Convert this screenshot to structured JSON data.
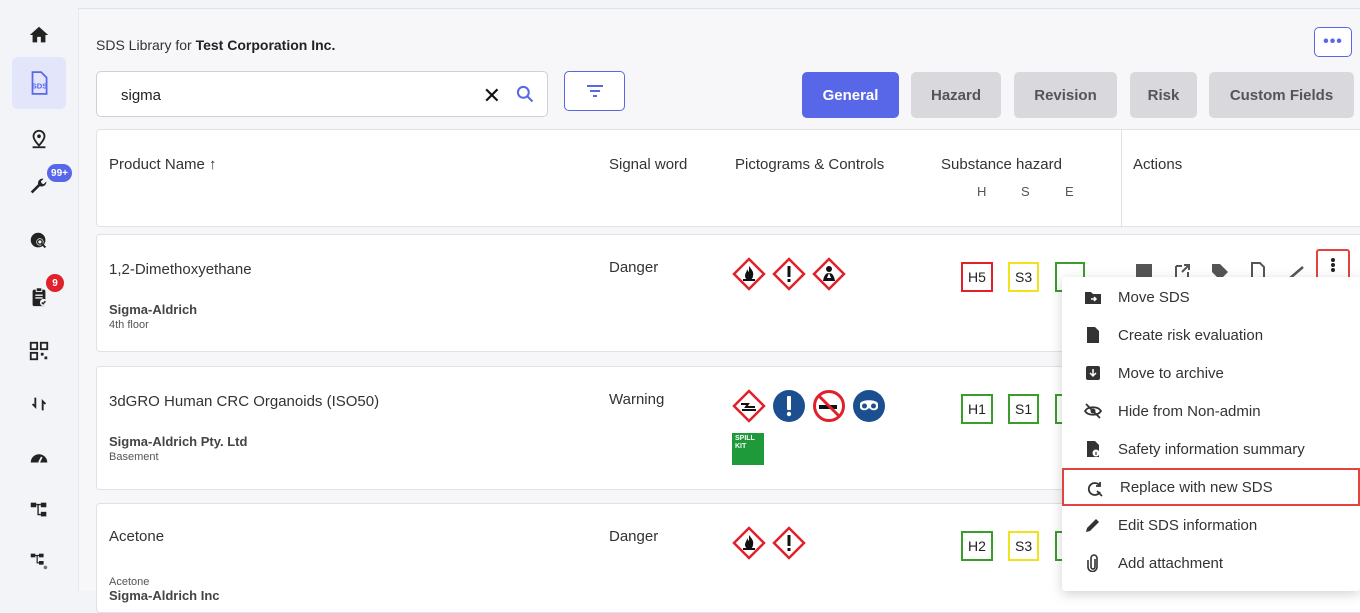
{
  "sidebar": {
    "items": [
      {
        "name": "home",
        "icon": "home-icon"
      },
      {
        "name": "sds",
        "icon": "sds-icon",
        "label": "SDS"
      },
      {
        "name": "locations",
        "icon": "location-pin-icon"
      },
      {
        "name": "tools",
        "icon": "wrench-icon",
        "badge": "99+"
      },
      {
        "name": "search-globe",
        "icon": "globe-search-icon"
      },
      {
        "name": "tasks",
        "icon": "clipboard-check-icon",
        "badge": "9"
      },
      {
        "name": "qr",
        "icon": "qr-code-icon"
      },
      {
        "name": "sync",
        "icon": "sync-icon"
      },
      {
        "name": "dashboard",
        "icon": "gauge-icon"
      },
      {
        "name": "org",
        "icon": "hierarchy-icon"
      },
      {
        "name": "org-users",
        "icon": "hierarchy-user-icon"
      }
    ]
  },
  "header": {
    "title_prefix": "SDS Library for ",
    "company": "Test Corporation Inc.",
    "more_label": "•••"
  },
  "search": {
    "value": "sigma",
    "clear_label": "✕"
  },
  "tabs": [
    {
      "label": "General",
      "active": true
    },
    {
      "label": "Hazard",
      "active": false
    },
    {
      "label": "Revision",
      "active": false
    },
    {
      "label": "Risk",
      "active": false
    },
    {
      "label": "Custom Fields",
      "active": false
    }
  ],
  "table": {
    "columns": {
      "product_name": "Product Name ↑",
      "signal_word": "Signal word",
      "pictograms": "Pictograms & Controls",
      "substance_hazard": "Substance hazard",
      "hse": [
        "H",
        "S",
        "E"
      ],
      "actions": "Actions"
    },
    "rows": [
      {
        "product": "1,2-Dimethoxyethane",
        "supplier": "Sigma-Aldrich",
        "location": "4th floor",
        "signal": "Danger",
        "h": "H5",
        "s": "S3",
        "e": "E"
      },
      {
        "product": "3dGRO Human CRC Organoids (ISO50)",
        "supplier": "Sigma-Aldrich Pty. Ltd",
        "location": "Basement",
        "signal": "Warning",
        "h": "H1",
        "s": "S1",
        "e": "",
        "kit_label": "SPILL KIT"
      },
      {
        "product": "Acetone",
        "subname": "Acetone",
        "supplier": "Sigma-Aldrich Inc",
        "signal": "Danger",
        "h": "H2",
        "s": "S3",
        "e": ""
      }
    ]
  },
  "context_menu": {
    "items": [
      {
        "label": "Move SDS",
        "icon": "folder-move-icon"
      },
      {
        "label": "Create risk evaluation",
        "icon": "file-icon"
      },
      {
        "label": "Move to archive",
        "icon": "archive-icon"
      },
      {
        "label": "Hide from Non-admin",
        "icon": "eye-off-icon"
      },
      {
        "label": "Safety information summary",
        "icon": "file-info-icon"
      },
      {
        "label": "Replace with new SDS",
        "icon": "replace-search-icon",
        "highlighted": true
      },
      {
        "label": "Edit SDS information",
        "icon": "pencil-icon"
      },
      {
        "label": "Add attachment",
        "icon": "paperclip-icon"
      }
    ]
  },
  "colors": {
    "accent": "#5866e8",
    "danger": "#e0202b",
    "warning_yellow": "#f0e21c",
    "green": "#3a9c2b",
    "highlight_border": "#e0443d"
  }
}
